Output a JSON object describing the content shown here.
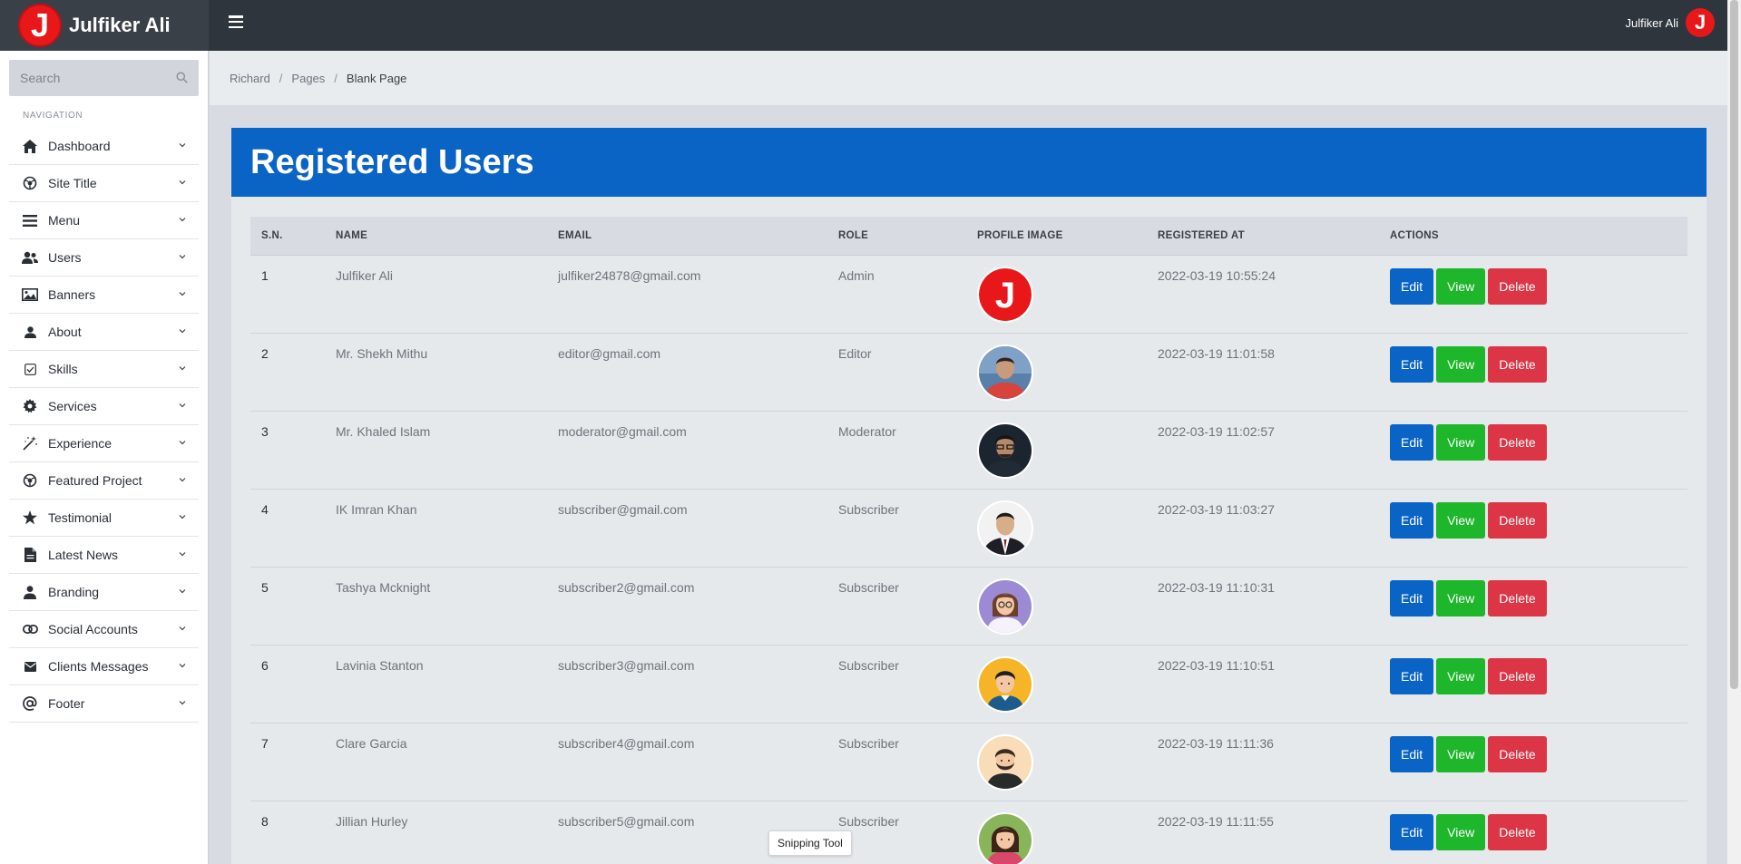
{
  "brand": {
    "name": "Julfiker Ali",
    "logo_letter": "J"
  },
  "topbar": {
    "user_name": "Julfiker Ali",
    "user_avatar_letter": "J"
  },
  "sidebar": {
    "search_placeholder": "Search",
    "nav_header": "NAVIGATION",
    "items": [
      {
        "label": "Dashboard",
        "icon": "home-icon"
      },
      {
        "label": "Site Title",
        "icon": "globe-icon"
      },
      {
        "label": "Menu",
        "icon": "bars-icon"
      },
      {
        "label": "Users",
        "icon": "users-icon"
      },
      {
        "label": "Banners",
        "icon": "image-icon"
      },
      {
        "label": "About",
        "icon": "user-icon"
      },
      {
        "label": "Skills",
        "icon": "checkbox-icon"
      },
      {
        "label": "Services",
        "icon": "gear-icon"
      },
      {
        "label": "Experience",
        "icon": "magic-wand-icon"
      },
      {
        "label": "Featured Project",
        "icon": "globe-icon"
      },
      {
        "label": "Testimonial",
        "icon": "star-icon"
      },
      {
        "label": "Latest News",
        "icon": "file-icon"
      },
      {
        "label": "Branding",
        "icon": "user-tie-icon"
      },
      {
        "label": "Social Accounts",
        "icon": "link-icon"
      },
      {
        "label": "Clients Messages",
        "icon": "envelope-icon"
      },
      {
        "label": "Footer",
        "icon": "at-icon"
      }
    ]
  },
  "breadcrumb": {
    "items": [
      "Richard",
      "Pages"
    ],
    "active": "Blank Page"
  },
  "panel": {
    "title": "Registered Users"
  },
  "table": {
    "headers": [
      "S.N.",
      "NAME",
      "EMAIL",
      "ROLE",
      "PROFILE IMAGE",
      "REGISTERED AT",
      "ACTIONS"
    ],
    "rows": [
      {
        "sn": "1",
        "name": "Julfiker Ali",
        "email": "julfiker24878@gmail.com",
        "role": "Admin",
        "avatar": "logo-j",
        "registered": "2022-03-19 10:55:24"
      },
      {
        "sn": "2",
        "name": "Mr. Shekh Mithu",
        "email": "editor@gmail.com",
        "role": "Editor",
        "avatar": "photo-man-red-shirt",
        "registered": "2022-03-19 11:01:58"
      },
      {
        "sn": "3",
        "name": "Mr. Khaled Islam",
        "email": "moderator@gmail.com",
        "role": "Moderator",
        "avatar": "photo-man-glasses",
        "registered": "2022-03-19 11:02:57"
      },
      {
        "sn": "4",
        "name": "IK Imran Khan",
        "email": "subscriber@gmail.com",
        "role": "Subscriber",
        "avatar": "photo-man-suit",
        "registered": "2022-03-19 11:03:27"
      },
      {
        "sn": "5",
        "name": "Tashya Mcknight",
        "email": "subscriber2@gmail.com",
        "role": "Subscriber",
        "avatar": "cartoon-woman-purple",
        "registered": "2022-03-19 11:10:31"
      },
      {
        "sn": "6",
        "name": "Lavinia Stanton",
        "email": "subscriber3@gmail.com",
        "role": "Subscriber",
        "avatar": "cartoon-man-orange",
        "registered": "2022-03-19 11:10:51"
      },
      {
        "sn": "7",
        "name": "Clare Garcia",
        "email": "subscriber4@gmail.com",
        "role": "Subscriber",
        "avatar": "cartoon-man-beard",
        "registered": "2022-03-19 11:11:36"
      },
      {
        "sn": "8",
        "name": "Jillian Hurley",
        "email": "subscriber5@gmail.com",
        "role": "Subscriber",
        "avatar": "cartoon-woman-green",
        "registered": "2022-03-19 11:11:55"
      }
    ],
    "actions": {
      "edit": "Edit",
      "view": "View",
      "delete": "Delete"
    }
  },
  "tooltip": {
    "text": "Snipping Tool"
  },
  "colors": {
    "primary": "#0a64c6",
    "success": "#1eb62a",
    "danger": "#dc3545",
    "topbar": "#2f353d",
    "brand_red": "#e8181a"
  }
}
